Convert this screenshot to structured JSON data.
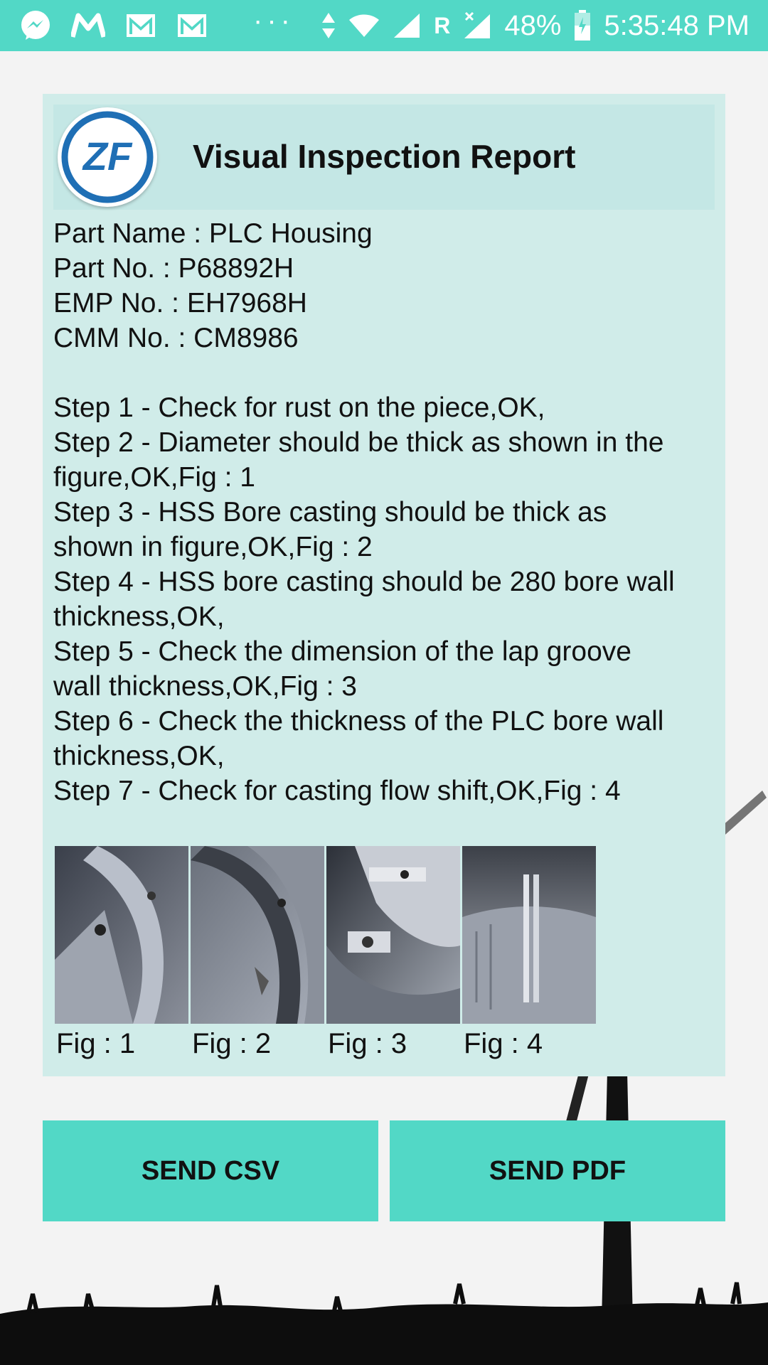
{
  "status_bar": {
    "battery": "48%",
    "time": "5:35:48 PM",
    "network_label": "R",
    "icons": [
      "messenger-icon",
      "gmail-m-icon",
      "mail-icon",
      "mail-icon",
      "more-dots-icon",
      "data-arrows-icon",
      "wifi-icon",
      "signal-icon",
      "no-signal-icon",
      "battery-icon"
    ]
  },
  "report": {
    "title": "Visual Inspection Report",
    "logo_text": "ZF",
    "fields": [
      "Part Name : PLC Housing",
      "Part No. : P68892H",
      "EMP No. : EH7968H",
      "CMM No. : CM8986"
    ],
    "steps": [
      "Step 1 - Check for rust on the piece,OK,",
      "Step 2 - Diameter should be thick as shown in the",
      "figure,OK,Fig : 1",
      "Step 3 - HSS Bore casting should be thick as",
      "shown in figure,OK,Fig : 2",
      "Step 4 - HSS bore casting should be 280 bore wall",
      "thickness,OK,",
      "Step 5 - Check the dimension of the lap groove",
      "wall thickness,OK,Fig : 3",
      "Step 6 - Check the thickness of the PLC bore wall",
      "thickness,OK,",
      "Step 7 - Check for casting flow shift,OK,Fig : 4"
    ],
    "figures": [
      "Fig : 1",
      "Fig : 2",
      "Fig : 3",
      "Fig : 4"
    ]
  },
  "actions": {
    "send_csv": "SEND CSV",
    "send_pdf": "SEND PDF"
  },
  "colors": {
    "accent": "#52d8c6",
    "card": "#d0ece9",
    "header": "#c4e7e5",
    "logo_blue": "#1f6fb5"
  }
}
